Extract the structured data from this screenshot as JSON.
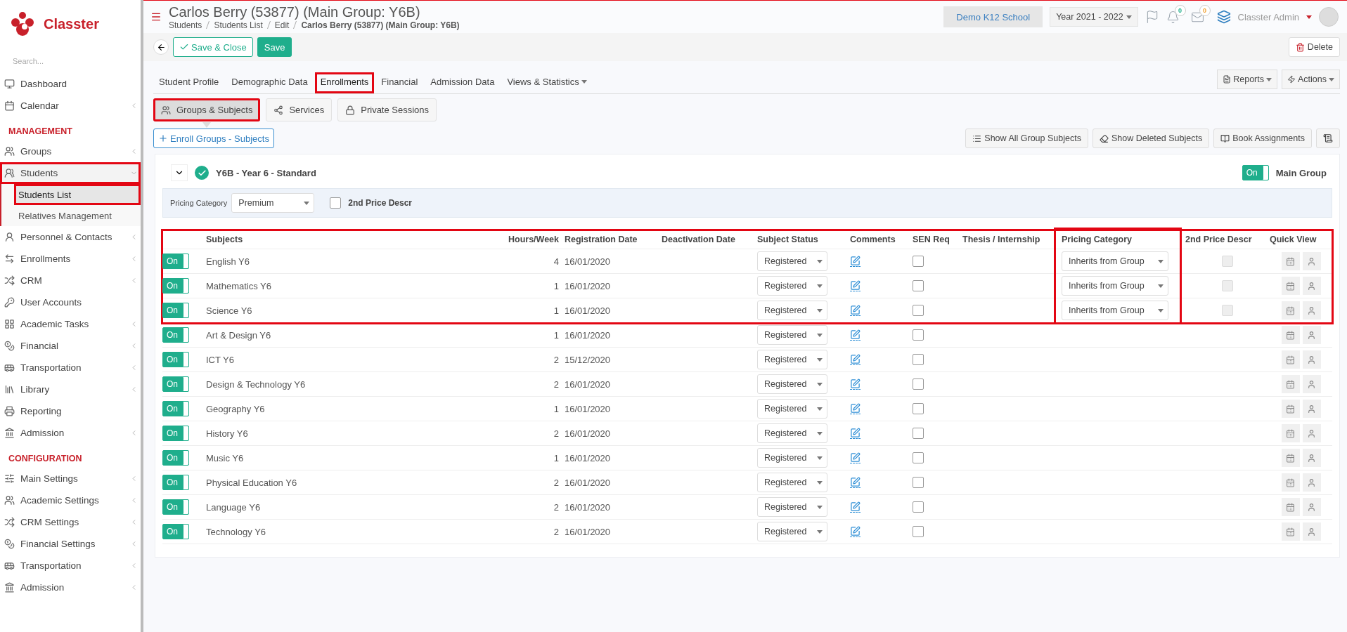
{
  "app": {
    "name": "Classter"
  },
  "sidebar": {
    "search_placeholder": "Search...",
    "sections": [
      {
        "items": [
          {
            "label": "Dashboard",
            "expandable": false,
            "expanded": false,
            "highlighted": false
          },
          {
            "label": "Calendar",
            "expandable": true,
            "expanded": false,
            "highlighted": false
          }
        ]
      },
      {
        "heading": "MANAGEMENT",
        "items": [
          {
            "label": "Groups",
            "expandable": true,
            "expanded": false,
            "highlighted": false
          },
          {
            "label": "Students",
            "expandable": true,
            "expanded": true,
            "highlighted": true,
            "children": [
              {
                "label": "Students List",
                "selected": true,
                "highlighted": true
              },
              {
                "label": "Relatives Management",
                "selected": false,
                "highlighted": false
              }
            ]
          },
          {
            "label": "Personnel & Contacts",
            "expandable": true,
            "expanded": false,
            "highlighted": false
          },
          {
            "label": "Enrollments",
            "expandable": true,
            "expanded": false,
            "highlighted": false
          },
          {
            "label": "CRM",
            "expandable": true,
            "expanded": false,
            "highlighted": false
          },
          {
            "label": "User Accounts",
            "expandable": false,
            "expanded": false,
            "highlighted": false
          },
          {
            "label": "Academic Tasks",
            "expandable": true,
            "expanded": false,
            "highlighted": false
          },
          {
            "label": "Financial",
            "expandable": true,
            "expanded": false,
            "highlighted": false
          },
          {
            "label": "Transportation",
            "expandable": true,
            "expanded": false,
            "highlighted": false
          },
          {
            "label": "Library",
            "expandable": true,
            "expanded": false,
            "highlighted": false
          },
          {
            "label": "Reporting",
            "expandable": false,
            "expanded": false,
            "highlighted": false
          },
          {
            "label": "Admission",
            "expandable": true,
            "expanded": false,
            "highlighted": false
          }
        ]
      },
      {
        "heading": "CONFIGURATION",
        "items": [
          {
            "label": "Main Settings",
            "expandable": true,
            "expanded": false,
            "highlighted": false
          },
          {
            "label": "Academic Settings",
            "expandable": true,
            "expanded": false,
            "highlighted": false
          },
          {
            "label": "CRM Settings",
            "expandable": true,
            "expanded": false,
            "highlighted": false
          },
          {
            "label": "Financial Settings",
            "expandable": true,
            "expanded": false,
            "highlighted": false
          },
          {
            "label": "Transportation",
            "expandable": true,
            "expanded": false,
            "highlighted": false
          },
          {
            "label": "Admission",
            "expandable": true,
            "expanded": false,
            "highlighted": false
          }
        ]
      }
    ]
  },
  "header": {
    "title": "Carlos Berry (53877) (Main Group: Y6B)",
    "breadcrumb": [
      "Students",
      "Students List",
      "Edit",
      "Carlos Berry (53877) (Main Group: Y6B)"
    ],
    "school": "Demo K12 School",
    "year": "Year 2021 - 2022",
    "notifications": "0",
    "messages": "0",
    "user": "Classter Admin"
  },
  "toolbar": {
    "save_close": "Save & Close",
    "save": "Save",
    "delete": "Delete"
  },
  "tabs": [
    {
      "label": "Student Profile",
      "selected": false,
      "highlighted": false,
      "dropdown": false
    },
    {
      "label": "Demographic Data",
      "selected": false,
      "highlighted": false,
      "dropdown": false
    },
    {
      "label": "Enrollments",
      "selected": true,
      "highlighted": true,
      "dropdown": false
    },
    {
      "label": "Financial",
      "selected": false,
      "highlighted": false,
      "dropdown": false
    },
    {
      "label": "Admission Data",
      "selected": false,
      "highlighted": false,
      "dropdown": false
    },
    {
      "label": "Views & Statistics",
      "selected": false,
      "highlighted": false,
      "dropdown": true
    }
  ],
  "tab_actions": [
    "Reports",
    "Actions"
  ],
  "subtabs": [
    {
      "label": "Groups & Subjects",
      "selected": true,
      "highlighted": true
    },
    {
      "label": "Services",
      "selected": false,
      "highlighted": false
    },
    {
      "label": "Private Sessions",
      "selected": false,
      "highlighted": false
    }
  ],
  "enroll_button": "Enroll Groups - Subjects",
  "tools": [
    "Show All Group Subjects",
    "Show Deleted Subjects",
    "Book Assignments"
  ],
  "group": {
    "title": "Y6B - Year 6 - Standard",
    "expanded": true,
    "main_group": {
      "on": true,
      "switch": "On",
      "label": "Main Group"
    },
    "pricing_label": "Pricing Category",
    "pricing_value": "Premium",
    "second_price": {
      "label": "2nd Price Descr",
      "checked": false
    }
  },
  "table": {
    "columns": [
      "Subjects",
      "Hours/Week",
      "Registration Date",
      "Deactivation Date",
      "Subject Status",
      "Comments",
      "SEN Req",
      "Thesis / Internship",
      "Pricing Category",
      "2nd Price Descr",
      "Quick View"
    ],
    "pricing_highlighted": true,
    "rows": [
      {
        "on": true,
        "switch": "On",
        "subject": "English Y6",
        "hours": "4",
        "registration_date": "16/01/2020",
        "status": "Registered",
        "sen_req": false,
        "pricing": "Inherits from Group",
        "second_price": false,
        "highlighted": true
      },
      {
        "on": true,
        "switch": "On",
        "subject": "Mathematics Y6",
        "hours": "1",
        "registration_date": "16/01/2020",
        "status": "Registered",
        "sen_req": false,
        "pricing": "Inherits from Group",
        "second_price": false,
        "highlighted": true
      },
      {
        "on": true,
        "switch": "On",
        "subject": "Science Y6",
        "hours": "1",
        "registration_date": "16/01/2020",
        "status": "Registered",
        "sen_req": false,
        "pricing": "Inherits from Group",
        "second_price": false,
        "highlighted": true
      },
      {
        "on": true,
        "switch": "On",
        "subject": "Art & Design Y6",
        "hours": "1",
        "registration_date": "16/01/2020",
        "status": "Registered",
        "sen_req": false,
        "highlighted": false
      },
      {
        "on": true,
        "switch": "On",
        "subject": "ICT Y6",
        "hours": "2",
        "registration_date": "15/12/2020",
        "status": "Registered",
        "sen_req": false,
        "highlighted": false
      },
      {
        "on": true,
        "switch": "On",
        "subject": "Design & Technology Y6",
        "hours": "2",
        "registration_date": "16/01/2020",
        "status": "Registered",
        "sen_req": false,
        "highlighted": false
      },
      {
        "on": true,
        "switch": "On",
        "subject": "Geography Y6",
        "hours": "1",
        "registration_date": "16/01/2020",
        "status": "Registered",
        "sen_req": false,
        "highlighted": false
      },
      {
        "on": true,
        "switch": "On",
        "subject": "History Y6",
        "hours": "2",
        "registration_date": "16/01/2020",
        "status": "Registered",
        "sen_req": false,
        "highlighted": false
      },
      {
        "on": true,
        "switch": "On",
        "subject": "Music Y6",
        "hours": "1",
        "registration_date": "16/01/2020",
        "status": "Registered",
        "sen_req": false,
        "highlighted": false
      },
      {
        "on": true,
        "switch": "On",
        "subject": "Physical Education Y6",
        "hours": "2",
        "registration_date": "16/01/2020",
        "status": "Registered",
        "sen_req": false,
        "highlighted": false
      },
      {
        "on": true,
        "switch": "On",
        "subject": "Language Y6",
        "hours": "2",
        "registration_date": "16/01/2020",
        "status": "Registered",
        "sen_req": false,
        "highlighted": false
      },
      {
        "on": true,
        "switch": "On",
        "subject": "Technology Y6",
        "hours": "2",
        "registration_date": "16/01/2020",
        "status": "Registered",
        "sen_req": false,
        "highlighted": false
      }
    ]
  }
}
